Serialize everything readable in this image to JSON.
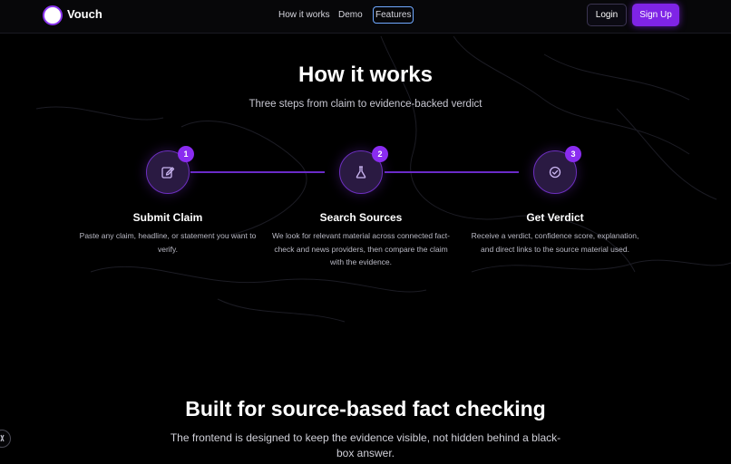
{
  "nav": {
    "brand": "Vouch",
    "links": [
      "How it works",
      "Demo",
      "Features"
    ],
    "login_label": "Login",
    "signup_label": "Sign Up"
  },
  "how_it_works": {
    "title": "How it works",
    "subtitle": "Three steps from claim to evidence-backed verdict",
    "steps": [
      {
        "number": "1",
        "icon": "edit-icon",
        "title": "Submit Claim",
        "description": "Paste any claim, headline, or statement you want to verify."
      },
      {
        "number": "2",
        "icon": "flask-icon",
        "title": "Search Sources",
        "description": "We look for relevant material across connected fact-check and news providers, then compare the claim with the evidence."
      },
      {
        "number": "3",
        "icon": "check-circle-icon",
        "title": "Get Verdict",
        "description": "Receive a verdict, confidence score, explanation, and direct links to the source material used."
      }
    ]
  },
  "features": {
    "title": "Built for source-based fact checking",
    "subtitle": "The frontend is designed to keep the evidence visible, not hidden behind a black-box answer."
  },
  "colors": {
    "accent": "#7f24e6",
    "background": "#000000",
    "focus_ring": "#6fa8ff"
  }
}
